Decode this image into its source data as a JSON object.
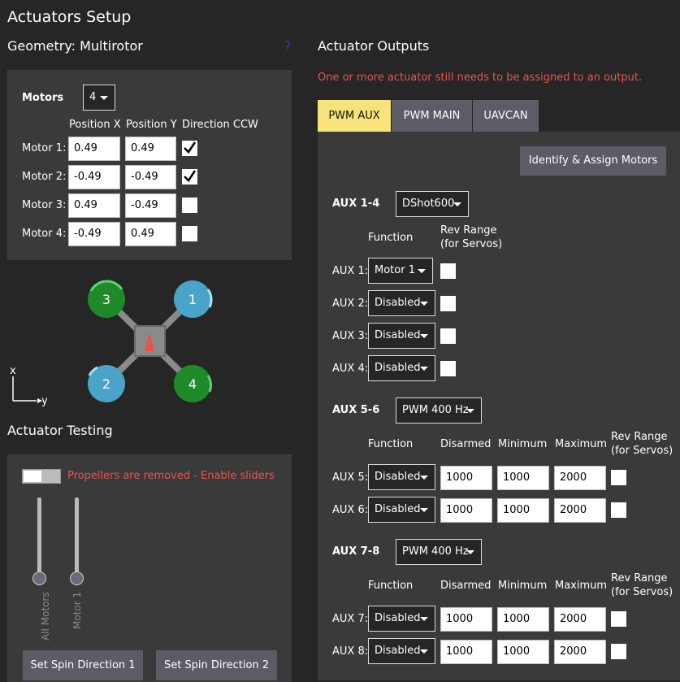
{
  "page_title": "Actuators Setup",
  "geometry": {
    "title": "Geometry: Multirotor",
    "help_icon": "?",
    "motors_label": "Motors",
    "motors_count": "4",
    "col_posx": "Position X",
    "col_posy": "Position Y",
    "col_dir": "Direction CCW",
    "motors": [
      {
        "label": "Motor 1:",
        "x": "0.49",
        "y": "0.49",
        "ccw": true
      },
      {
        "label": "Motor 2:",
        "x": "-0.49",
        "y": "-0.49",
        "ccw": true
      },
      {
        "label": "Motor 3:",
        "x": "0.49",
        "y": "-0.49",
        "ccw": false
      },
      {
        "label": "Motor 4:",
        "x": "-0.49",
        "y": "0.49",
        "ccw": false
      }
    ],
    "diagram": {
      "rotor_labels": [
        "3",
        "1",
        "2",
        "4"
      ],
      "axis_x": "x",
      "axis_y": "y",
      "colors": {
        "green": "#1f8a2a",
        "blue": "#4aa3c8",
        "frame": "#8a8a8a",
        "arrow": "#e8534c"
      }
    }
  },
  "testing": {
    "title": "Actuator Testing",
    "notice": "Propellers are removed - Enable sliders",
    "sliders": [
      {
        "label": "All Motors",
        "value": 0
      },
      {
        "label": "Motor 1",
        "value": 0
      }
    ],
    "button1": "Set Spin Direction 1",
    "button2": "Set Spin Direction 2"
  },
  "outputs": {
    "title": "Actuator Outputs",
    "warning": "One or more actuator still needs to be assigned to an output.",
    "tabs": [
      "PWM AUX",
      "PWM MAIN",
      "UAVCAN"
    ],
    "active_tab": "PWM AUX",
    "identify_button": "Identify & Assign Motors",
    "group1": {
      "label": "AUX 1-4",
      "protocol": "DShot600",
      "col_function": "Function",
      "col_rev1": "Rev Range",
      "col_rev2": "(for Servos)",
      "rows": [
        {
          "label": "AUX 1:",
          "function": "Motor 1"
        },
        {
          "label": "AUX 2:",
          "function": "Disabled"
        },
        {
          "label": "AUX 3:",
          "function": "Disabled"
        },
        {
          "label": "AUX 4:",
          "function": "Disabled"
        }
      ]
    },
    "group2": {
      "label": "AUX 5-6",
      "protocol": "PWM 400 Hz",
      "col_function": "Function",
      "col_disarmed": "Disarmed",
      "col_minimum": "Minimum",
      "col_maximum": "Maximum",
      "col_rev1": "Rev Range",
      "col_rev2": "(for Servos)",
      "rows": [
        {
          "label": "AUX 5:",
          "function": "Disabled",
          "disarmed": "1000",
          "minimum": "1000",
          "maximum": "2000"
        },
        {
          "label": "AUX 6:",
          "function": "Disabled",
          "disarmed": "1000",
          "minimum": "1000",
          "maximum": "2000"
        }
      ]
    },
    "group3": {
      "label": "AUX 7-8",
      "protocol": "PWM 400 Hz",
      "col_function": "Function",
      "col_disarmed": "Disarmed",
      "col_minimum": "Minimum",
      "col_maximum": "Maximum",
      "col_rev1": "Rev Range",
      "col_rev2": "(for Servos)",
      "rows": [
        {
          "label": "AUX 7:",
          "function": "Disabled",
          "disarmed": "1000",
          "minimum": "1000",
          "maximum": "2000"
        },
        {
          "label": "AUX 8:",
          "function": "Disabled",
          "disarmed": "1000",
          "minimum": "1000",
          "maximum": "2000"
        }
      ]
    }
  }
}
